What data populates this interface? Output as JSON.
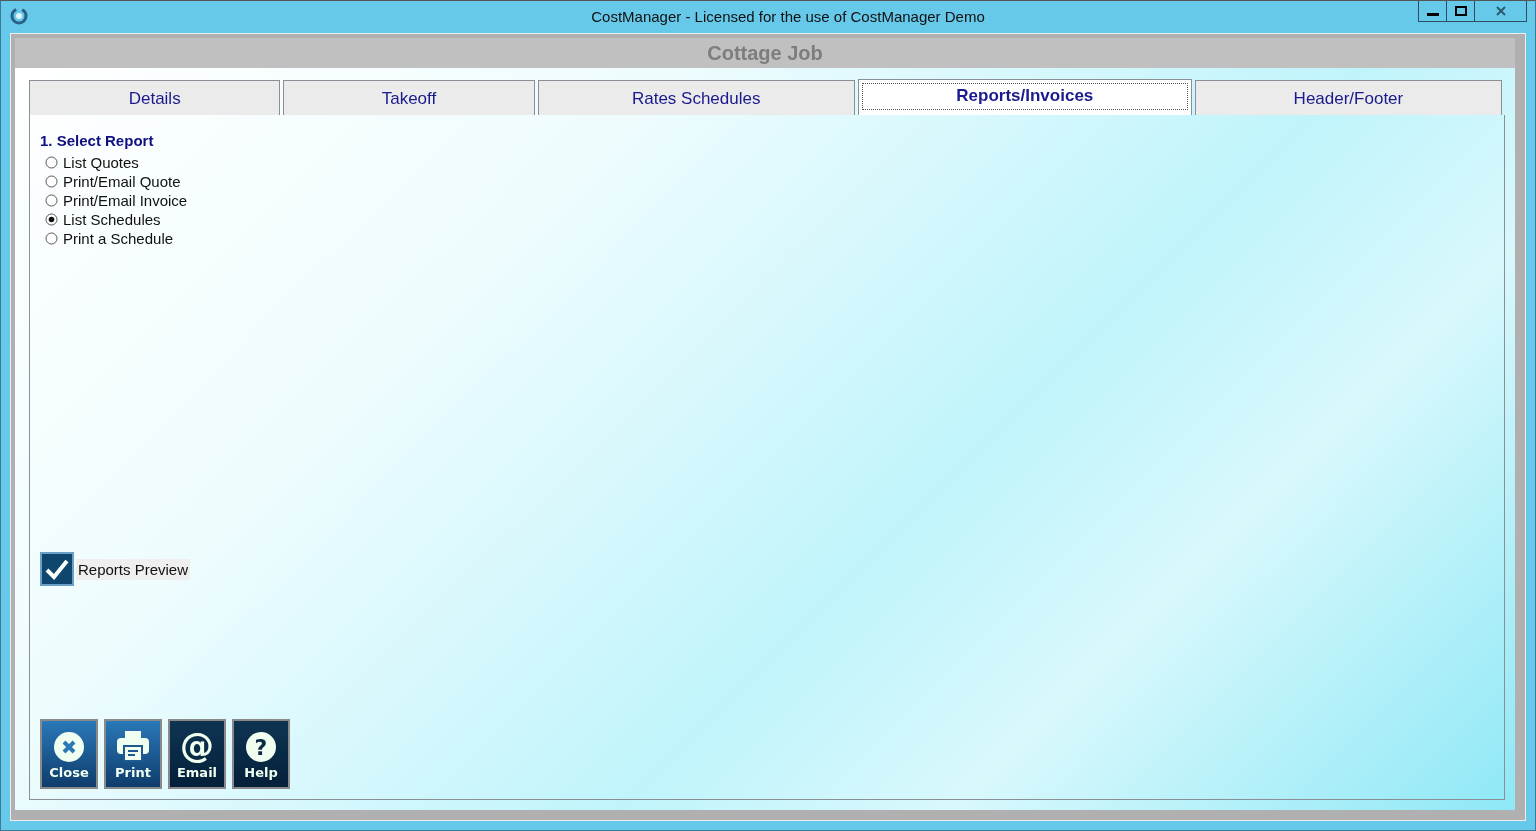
{
  "window": {
    "title": "CostManager - Licensed for the use of CostManager Demo"
  },
  "header": {
    "title": "Cottage Job"
  },
  "tabs": [
    {
      "label": "Details",
      "selected": false
    },
    {
      "label": "Takeoff",
      "selected": false
    },
    {
      "label": "Rates Schedules",
      "selected": false
    },
    {
      "label": "Reports/Invoices",
      "selected": true
    },
    {
      "label": "Header/Footer",
      "selected": false
    }
  ],
  "report_section": {
    "heading": "1. Select Report",
    "options": [
      {
        "label": "List Quotes",
        "selected": false
      },
      {
        "label": "Print/Email Quote",
        "selected": false
      },
      {
        "label": "Print/Email Invoice",
        "selected": false
      },
      {
        "label": "List Schedules",
        "selected": true
      },
      {
        "label": "Print a Schedule",
        "selected": false
      }
    ]
  },
  "reports_preview": {
    "label": "Reports Preview",
    "checked": true
  },
  "buttons": [
    {
      "kind": "close",
      "label": "Close"
    },
    {
      "kind": "print",
      "label": "Print"
    },
    {
      "kind": "email",
      "label": "Email",
      "glyph": "@"
    },
    {
      "kind": "help",
      "label": "Help",
      "glyph": "?"
    }
  ]
}
